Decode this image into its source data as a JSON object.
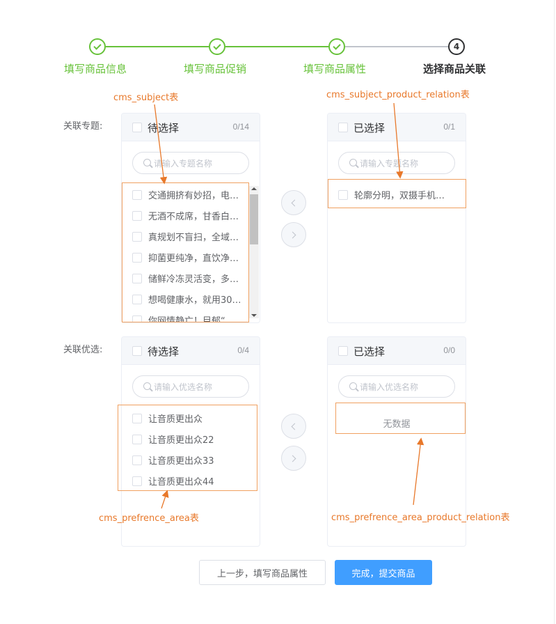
{
  "steps": [
    {
      "title": "填写商品信息",
      "status": "finish"
    },
    {
      "title": "填写商品促销",
      "status": "finish"
    },
    {
      "title": "填写商品属性",
      "status": "finish"
    },
    {
      "title": "选择商品关联",
      "status": "process",
      "number": "4"
    }
  ],
  "colors": {
    "finish": "#67c23a",
    "process": "#303133",
    "primary": "#409eff",
    "annotation": "#e8782a"
  },
  "subject": {
    "label": "关联专题:",
    "left": {
      "title": "待选择",
      "count": "0/14",
      "placeholder": "请输入专题名称",
      "items": [
        "交通拥挤有妙招，电…",
        "无酒不成席，甘香白…",
        "真规划不盲扫，全域…",
        "抑菌更纯净，直饮净…",
        "储鲜冷冻灵活变，多…",
        "想喝健康水，就用30…",
        "你网情静亡！目郁“"
      ]
    },
    "right": {
      "title": "已选择",
      "count": "0/1",
      "placeholder": "请输入专题名称",
      "items": [
        "轮廓分明，双摄手机映…"
      ]
    }
  },
  "preference": {
    "label": "关联优选:",
    "left": {
      "title": "待选择",
      "count": "0/4",
      "placeholder": "请输入优选名称",
      "items": [
        "让音质更出众",
        "让音质更出众22",
        "让音质更出众33",
        "让音质更出众44"
      ]
    },
    "right": {
      "title": "已选择",
      "count": "0/0",
      "placeholder": "请输入优选名称",
      "empty_text": "无数据"
    }
  },
  "annotations": {
    "subject": "cms_subject表",
    "subject_relation": "cms_subject_product_relation表",
    "prefrence_area": "cms_prefrence_area表",
    "prefrence_relation": "cms_prefrence_area_product_relation表"
  },
  "buttons": {
    "prev": "上一步，填写商品属性",
    "submit": "完成，提交商品"
  }
}
